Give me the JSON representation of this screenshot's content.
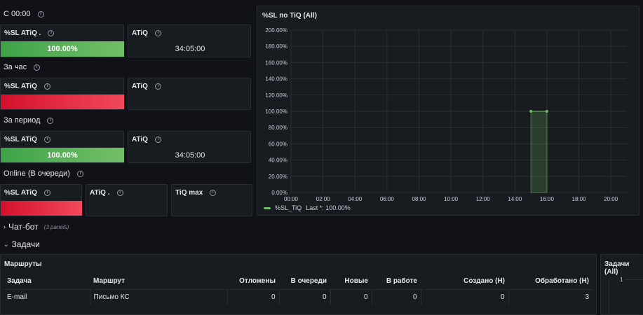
{
  "rows": {
    "since": "С 00:00",
    "hour": "За час",
    "period": "За период",
    "online": "Online (В очереди)"
  },
  "stats": {
    "since_sl_title": "%SL ATiQ .",
    "since_sl_value": "100.00%",
    "since_atiq_title": "ATiQ",
    "since_atiq_value": "34:05:00",
    "hour_sl_title": "%SL ATiQ",
    "hour_atiq_title": "ATiQ",
    "period_sl_title": "%SL ATiQ",
    "period_sl_value": "100.00%",
    "period_atiq_title": "ATiQ",
    "period_atiq_value": "34:05:00",
    "online_sl_title": "%SL ATiQ",
    "online_atiq_title": "ATiQ .",
    "online_tiq_title": "TiQ max"
  },
  "bar_colors": {
    "green": "#73bf69",
    "red": "#f2495c"
  },
  "chart": {
    "panel_title": "%SL по TiQ (All)",
    "legend_label": "%SL_TiQ",
    "legend_last": "Last *: 100.00%"
  },
  "chart_data": {
    "type": "area",
    "x_ticks": [
      "00:00",
      "02:00",
      "04:00",
      "06:00",
      "08:00",
      "10:00",
      "12:00",
      "14:00",
      "16:00",
      "18:00",
      "20:00"
    ],
    "y_ticks": [
      "0.00%",
      "20.00%",
      "40.00%",
      "60.00%",
      "80.00%",
      "100.00%",
      "120.00%",
      "140.00%",
      "160.00%",
      "180.00%",
      "200.00%"
    ],
    "ylim": [
      0,
      200
    ],
    "xlim": [
      "00:00",
      "21:00"
    ],
    "series": [
      {
        "name": "%SL_TiQ",
        "color": "#73bf69",
        "points": [
          {
            "x": "15:00",
            "y": 100
          },
          {
            "x": "16:00",
            "y": 100
          }
        ]
      }
    ],
    "grid": true,
    "legend": "bottom-left"
  },
  "sections": {
    "chatbot_label": "Чат-бот",
    "chatbot_sub": "(3 panels)",
    "tasks_label": "Задачи"
  },
  "routes": {
    "panel_title": "Маршруты",
    "columns": [
      "Задача",
      "Маршрут",
      "Отложены",
      "В очереди",
      "Новые",
      "В работе",
      "Создано (Н)",
      "Обработано (Н)"
    ],
    "rows": [
      [
        "E-mail",
        "Письмо КС",
        "0",
        "0",
        "0",
        "0",
        "0",
        "3"
      ]
    ]
  },
  "tasks_panel": {
    "title": "Задачи (All)",
    "tick": "1"
  }
}
